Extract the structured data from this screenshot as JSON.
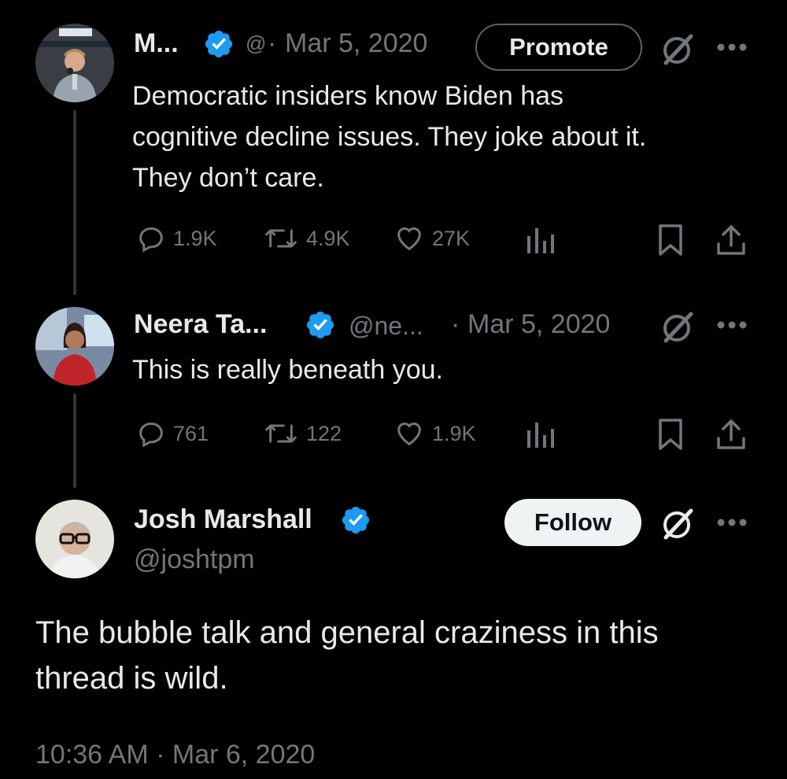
{
  "colors": {
    "background": "#000000",
    "text": "#e7e9ea",
    "muted": "#71767b",
    "verified": "#1d9bf0"
  },
  "tweets": [
    {
      "name": "M...",
      "handle": "@",
      "separator": "·",
      "date": "Mar 5, 2020",
      "button": "Promote",
      "text_lines": [
        "Democratic insiders know Biden has",
        "cognitive decline issues. They joke about it.",
        "They don’t care."
      ],
      "replies": "1.9K",
      "reposts": "4.9K",
      "likes": "27K",
      "icons": [
        "verified-badge-icon",
        "grok-icon",
        "more-icon",
        "reply-icon",
        "repost-icon",
        "like-icon",
        "views-icon",
        "bookmark-icon",
        "share-icon"
      ]
    },
    {
      "name": "Neera Ta...",
      "handle": "@ne...",
      "separator": "·",
      "date": "Mar 5, 2020",
      "text_lines": [
        "This is really beneath you."
      ],
      "replies": "761",
      "reposts": "122",
      "likes": "1.9K"
    }
  ],
  "main_tweet": {
    "name": "Josh Marshall",
    "handle": "@joshtpm",
    "button": "Follow",
    "text_lines": [
      "The bubble talk and general craziness in this",
      "thread is wild."
    ],
    "timestamp": "10:36 AM · Mar 6, 2020"
  }
}
